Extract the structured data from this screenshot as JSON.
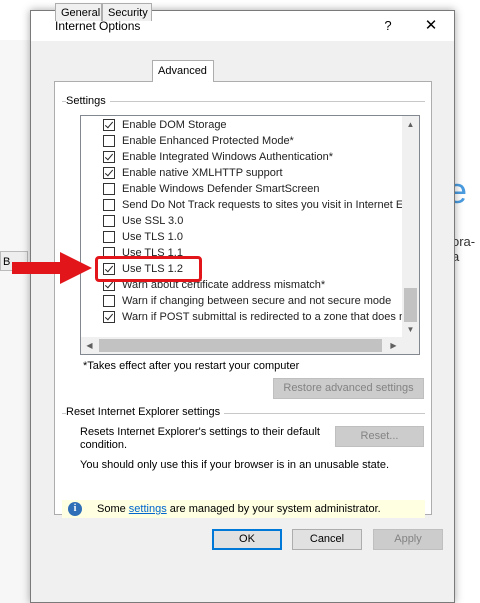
{
  "background": {
    "side_letter": "B",
    "big_letter": "e",
    "fragment_text": "ora-a"
  },
  "dialog": {
    "title": "Internet Options",
    "help_label": "?",
    "close_label": "✕",
    "tabs": [
      {
        "label": "General",
        "active": false
      },
      {
        "label": "Security",
        "active": false
      },
      {
        "label": "Advanced",
        "active": true
      }
    ],
    "settings_label": "Settings",
    "settings_items": [
      {
        "label": "Enable DOM Storage",
        "checked": true
      },
      {
        "label": "Enable Enhanced Protected Mode*",
        "checked": false
      },
      {
        "label": "Enable Integrated Windows Authentication*",
        "checked": true
      },
      {
        "label": "Enable native XMLHTTP support",
        "checked": true
      },
      {
        "label": "Enable Windows Defender SmartScreen",
        "checked": false
      },
      {
        "label": "Send Do Not Track requests to sites you visit in Internet E",
        "checked": false
      },
      {
        "label": "Use SSL 3.0",
        "checked": false
      },
      {
        "label": "Use TLS 1.0",
        "checked": false
      },
      {
        "label": "Use TLS 1.1",
        "checked": false
      },
      {
        "label": "Use TLS 1.2",
        "checked": true
      },
      {
        "label": "Warn about certificate address mismatch*",
        "checked": true
      },
      {
        "label": "Warn if changing between secure and not secure mode",
        "checked": false
      },
      {
        "label": "Warn if POST submittal is redirected to a zone that does n",
        "checked": true
      }
    ],
    "restart_note": "*Takes effect after you restart your computer",
    "restore_button": "Restore advanced settings",
    "reset_section_label": "Reset Internet Explorer settings",
    "reset_description": "Resets Internet Explorer's settings to their default condition.",
    "reset_button": "Reset...",
    "reset_warning": "You should only use this if your browser is in an unusable state.",
    "admin_notice_prefix": "Some ",
    "admin_notice_link": "settings",
    "admin_notice_suffix": " are managed by your system administrator.",
    "ok_button": "OK",
    "cancel_button": "Cancel",
    "apply_button": "Apply"
  },
  "colors": {
    "highlight": "#e2151b",
    "accent": "#0078d7"
  }
}
